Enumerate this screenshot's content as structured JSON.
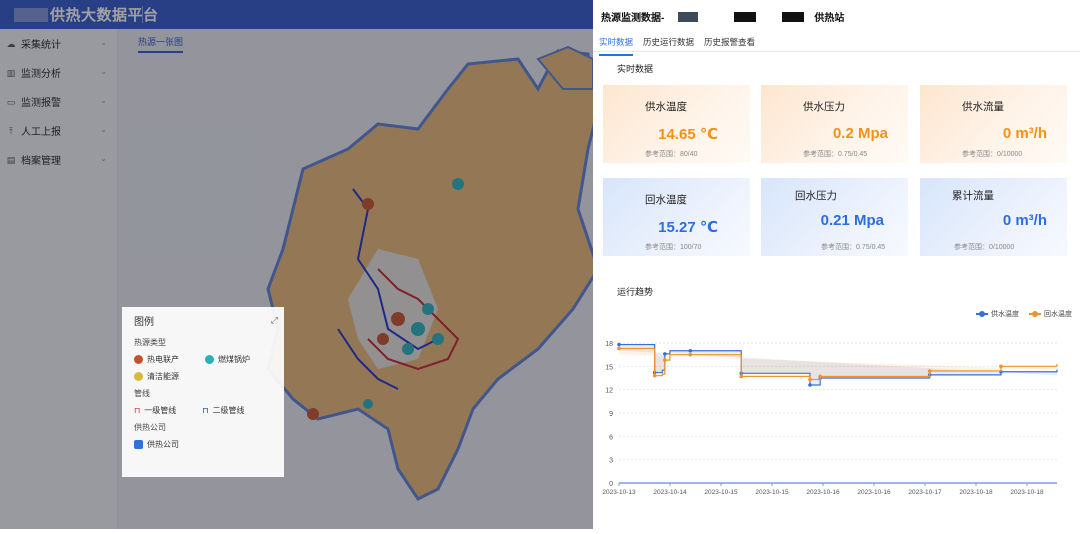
{
  "app": {
    "title": "供热大数据平台"
  },
  "sidebar": {
    "items": [
      {
        "label": "采集统计",
        "icon": "cloud-icon"
      },
      {
        "label": "监测分析",
        "icon": "chart-icon"
      },
      {
        "label": "监测报警",
        "icon": "monitor-icon"
      },
      {
        "label": "人工上报",
        "icon": "upload-icon"
      },
      {
        "label": "档案管理",
        "icon": "archive-icon"
      }
    ]
  },
  "map": {
    "tab": "热源一张图"
  },
  "legend": {
    "title": "图例",
    "group1": "热源类型",
    "items1": [
      "热电联产",
      "燃煤锅炉",
      "清洁能源"
    ],
    "group2": "管线",
    "items2": [
      "一级管线",
      "二级管线"
    ],
    "group3": "供热公司",
    "items3": [
      "供热公司"
    ]
  },
  "panel": {
    "title_prefix": "热源监测数据-",
    "title_suffix": "供热站",
    "tabs": [
      "实时数据",
      "历史运行数据",
      "历史报警查看"
    ],
    "realtime_title": "实时数据",
    "cards": [
      {
        "label": "供水温度",
        "value": "14.65 ℃",
        "ref": "参考范围：80/40"
      },
      {
        "label": "供水压力",
        "value": "0.2 Mpa",
        "ref": "参考范围：0.75/0.45"
      },
      {
        "label": "供水流量",
        "value": "0 m³/h",
        "ref": "参考范围：0/10000"
      },
      {
        "label": "回水温度",
        "value": "15.27 ℃",
        "ref": "参考范围：100/70"
      },
      {
        "label": "回水压力",
        "value": "0.21 Mpa",
        "ref": "参考范围：0.75/0.45"
      },
      {
        "label": "累计流量",
        "value": "0 m³/h",
        "ref": "参考范围：0/10000"
      }
    ],
    "trend_title": "运行趋势"
  },
  "colors": {
    "supply": "#3b6fd8",
    "return": "#f0922a",
    "accent": "#2f6fe0"
  },
  "chart_data": {
    "type": "line",
    "ylim": [
      0,
      18
    ],
    "yticks": [
      0,
      3,
      6,
      9,
      12,
      15,
      18
    ],
    "xtick_labels": [
      "2023-10-13",
      "2023-10-14",
      "2023-10-15",
      "2023-10-15",
      "2023-10-16",
      "2023-10-16",
      "2023-10-17",
      "2023-10-18",
      "2023-10-18"
    ],
    "grid": true,
    "legend_position": "top-right",
    "series": [
      {
        "name": "供水温度",
        "x": [
          0,
          0.65,
          0.7,
          0.85,
          0.9,
          1.0,
          1.4,
          2.35,
          2.4,
          3.7,
          3.75,
          3.9,
          3.95,
          6.0,
          6.1,
          6.6,
          7.5,
          8.6
        ],
        "values": [
          17.8,
          17.8,
          14.2,
          14.5,
          16.6,
          17.0,
          17.0,
          17.0,
          14.1,
          14.1,
          12.6,
          12.6,
          13.5,
          13.5,
          13.9,
          13.9,
          14.3,
          14.6
        ]
      },
      {
        "name": "回水温度",
        "x": [
          0,
          0.65,
          0.7,
          0.85,
          0.9,
          1.0,
          1.4,
          2.35,
          2.4,
          3.7,
          3.75,
          3.9,
          3.95,
          6.0,
          6.1,
          6.6,
          7.5,
          8.6
        ],
        "values": [
          17.3,
          17.3,
          13.8,
          14.0,
          15.8,
          16.5,
          16.5,
          16.5,
          13.7,
          13.7,
          13.3,
          13.3,
          13.7,
          13.7,
          14.4,
          14.4,
          15.0,
          15.3
        ]
      }
    ]
  }
}
